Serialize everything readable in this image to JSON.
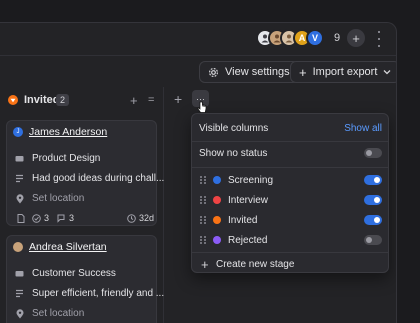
{
  "header": {
    "avatars": [
      {
        "initial": "",
        "color": "#e5e7eb"
      },
      {
        "initial": "",
        "color": "#c8a27a"
      },
      {
        "initial": "",
        "color": "#d9c3a8"
      },
      {
        "initial": "A",
        "color": "#e0a21a"
      },
      {
        "initial": "V",
        "color": "#2f6fe0"
      }
    ],
    "member_count": "9",
    "add_symbol": "+"
  },
  "toolbar": {
    "view_settings_label": "View settings",
    "import_export_label": "Import export"
  },
  "column": {
    "title": "Invited",
    "count": "2",
    "stage_color": "#f97316",
    "add_symbol": "+",
    "menu_symbol": "=",
    "add_column_symbol": "+",
    "more_symbol": "···"
  },
  "cards": [
    {
      "name": "James Anderson",
      "avatar_color": "#2f6fe0",
      "avatar_initial": "J",
      "job": "Product Design",
      "note": "Had good ideas during chall...",
      "location": "Set location",
      "checks": "3",
      "comments": "3",
      "age": "32d"
    },
    {
      "name": "Andrea Silvertan",
      "avatar_color": "#c8a27a",
      "avatar_initial": "",
      "job": "Customer Success",
      "note": "Super efficient, friendly and ...",
      "location": "Set location"
    }
  ],
  "popover": {
    "title": "Visible columns",
    "show_all_label": "Show all",
    "no_status_label": "Show no status",
    "no_status_on": false,
    "stages": [
      {
        "label": "Screening",
        "color": "#2f6fe0",
        "on": true
      },
      {
        "label": "Interview",
        "color": "#ef4444",
        "on": true
      },
      {
        "label": "Invited",
        "color": "#f97316",
        "on": true
      },
      {
        "label": "Rejected",
        "color": "#8b5cf6",
        "on": false
      }
    ],
    "create_label": "Create new stage"
  }
}
